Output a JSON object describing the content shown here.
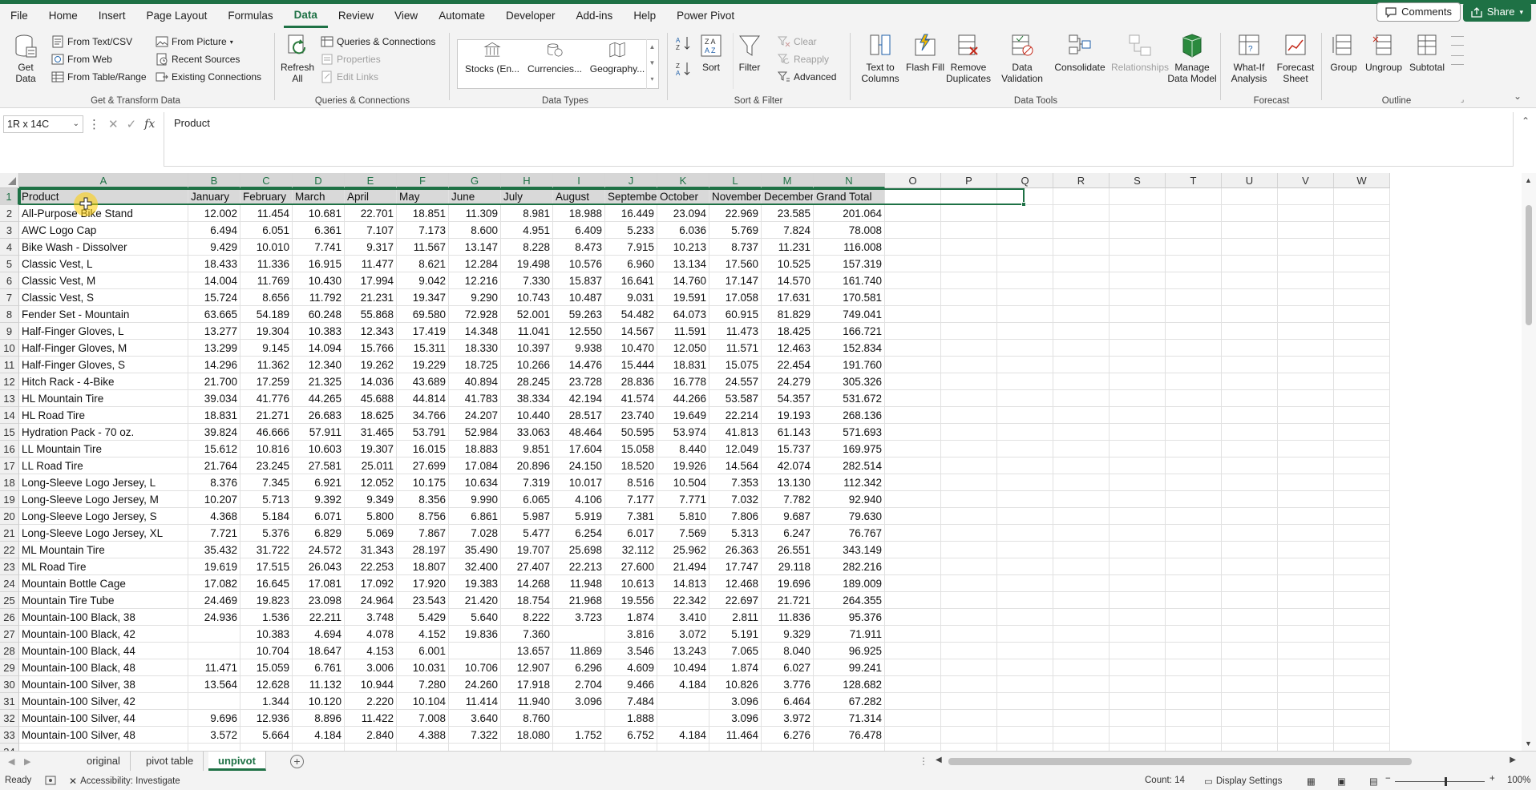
{
  "menu": {
    "items": [
      "File",
      "Home",
      "Insert",
      "Page Layout",
      "Formulas",
      "Data",
      "Review",
      "View",
      "Automate",
      "Developer",
      "Add-ins",
      "Help",
      "Power Pivot"
    ],
    "active": "Data",
    "comments_label": "Comments",
    "share_label": "Share"
  },
  "ribbon": {
    "get_data": {
      "get_data_label": "Get Data",
      "from_text_csv": "From Text/CSV",
      "from_web": "From Web",
      "from_table_range": "From Table/Range",
      "from_picture": "From Picture",
      "recent_sources": "Recent Sources",
      "existing_connections": "Existing Connections",
      "group_label": "Get & Transform Data"
    },
    "queries": {
      "refresh_all": "Refresh All",
      "queries_connections": "Queries & Connections",
      "properties": "Properties",
      "edit_links": "Edit Links",
      "group_label": "Queries & Connections"
    },
    "data_types": {
      "stocks": "Stocks (En...",
      "currencies": "Currencies...",
      "geography": "Geography...",
      "group_label": "Data Types"
    },
    "sort_filter": {
      "sort": "Sort",
      "filter": "Filter",
      "clear": "Clear",
      "reapply": "Reapply",
      "advanced": "Advanced",
      "group_label": "Sort & Filter"
    },
    "data_tools": {
      "text_to_columns": "Text to Columns",
      "flash_fill": "Flash Fill",
      "remove_duplicates": "Remove Duplicates",
      "data_validation": "Data Validation",
      "consolidate": "Consolidate",
      "relationships": "Relationships",
      "manage_data_model": "Manage Data Model",
      "group_label": "Data Tools"
    },
    "forecast": {
      "what_if": "What-If Analysis",
      "forecast_sheet": "Forecast Sheet",
      "group_label": "Forecast"
    },
    "outline": {
      "group": "Group",
      "ungroup": "Ungroup",
      "subtotal": "Subtotal",
      "group_label": "Outline"
    }
  },
  "formula_bar": {
    "name_box": "1R x 14C",
    "fx": "fx",
    "content": "Product"
  },
  "grid": {
    "columns": [
      "A",
      "B",
      "C",
      "D",
      "E",
      "F",
      "G",
      "H",
      "I",
      "J",
      "K",
      "L",
      "M",
      "N",
      "O",
      "P",
      "Q",
      "R",
      "S",
      "T",
      "U",
      "V",
      "W"
    ],
    "rows": [
      [
        "Product",
        "January",
        "February",
        "March",
        "April",
        "May",
        "June",
        "July",
        "August",
        "September",
        "October",
        "November",
        "December",
        "Grand Total"
      ],
      [
        "All-Purpose Bike Stand",
        "12.002",
        "11.454",
        "10.681",
        "22.701",
        "18.851",
        "11.309",
        "8.981",
        "18.988",
        "16.449",
        "23.094",
        "22.969",
        "23.585",
        "201.064"
      ],
      [
        "AWC Logo Cap",
        "6.494",
        "6.051",
        "6.361",
        "7.107",
        "7.173",
        "8.600",
        "4.951",
        "6.409",
        "5.233",
        "6.036",
        "5.769",
        "7.824",
        "78.008"
      ],
      [
        "Bike Wash - Dissolver",
        "9.429",
        "10.010",
        "7.741",
        "9.317",
        "11.567",
        "13.147",
        "8.228",
        "8.473",
        "7.915",
        "10.213",
        "8.737",
        "11.231",
        "116.008"
      ],
      [
        "Classic Vest, L",
        "18.433",
        "11.336",
        "16.915",
        "11.477",
        "8.621",
        "12.284",
        "19.498",
        "10.576",
        "6.960",
        "13.134",
        "17.560",
        "10.525",
        "157.319"
      ],
      [
        "Classic Vest, M",
        "14.004",
        "11.769",
        "10.430",
        "17.994",
        "9.042",
        "12.216",
        "7.330",
        "15.837",
        "16.641",
        "14.760",
        "17.147",
        "14.570",
        "161.740"
      ],
      [
        "Classic Vest, S",
        "15.724",
        "8.656",
        "11.792",
        "21.231",
        "19.347",
        "9.290",
        "10.743",
        "10.487",
        "9.031",
        "19.591",
        "17.058",
        "17.631",
        "170.581"
      ],
      [
        "Fender Set - Mountain",
        "63.665",
        "54.189",
        "60.248",
        "55.868",
        "69.580",
        "72.928",
        "52.001",
        "59.263",
        "54.482",
        "64.073",
        "60.915",
        "81.829",
        "749.041"
      ],
      [
        "Half-Finger Gloves, L",
        "13.277",
        "19.304",
        "10.383",
        "12.343",
        "17.419",
        "14.348",
        "11.041",
        "12.550",
        "14.567",
        "11.591",
        "11.473",
        "18.425",
        "166.721"
      ],
      [
        "Half-Finger Gloves, M",
        "13.299",
        "9.145",
        "14.094",
        "15.766",
        "15.311",
        "18.330",
        "10.397",
        "9.938",
        "10.470",
        "12.050",
        "11.571",
        "12.463",
        "152.834"
      ],
      [
        "Half-Finger Gloves, S",
        "14.296",
        "11.362",
        "12.340",
        "19.262",
        "19.229",
        "18.725",
        "10.266",
        "14.476",
        "15.444",
        "18.831",
        "15.075",
        "22.454",
        "191.760"
      ],
      [
        "Hitch Rack - 4-Bike",
        "21.700",
        "17.259",
        "21.325",
        "14.036",
        "43.689",
        "40.894",
        "28.245",
        "23.728",
        "28.836",
        "16.778",
        "24.557",
        "24.279",
        "305.326"
      ],
      [
        "HL Mountain Tire",
        "39.034",
        "41.776",
        "44.265",
        "45.688",
        "44.814",
        "41.783",
        "38.334",
        "42.194",
        "41.574",
        "44.266",
        "53.587",
        "54.357",
        "531.672"
      ],
      [
        "HL Road Tire",
        "18.831",
        "21.271",
        "26.683",
        "18.625",
        "34.766",
        "24.207",
        "10.440",
        "28.517",
        "23.740",
        "19.649",
        "22.214",
        "19.193",
        "268.136"
      ],
      [
        "Hydration Pack - 70 oz.",
        "39.824",
        "46.666",
        "57.911",
        "31.465",
        "53.791",
        "52.984",
        "33.063",
        "48.464",
        "50.595",
        "53.974",
        "41.813",
        "61.143",
        "571.693"
      ],
      [
        "LL Mountain Tire",
        "15.612",
        "10.816",
        "10.603",
        "19.307",
        "16.015",
        "18.883",
        "9.851",
        "17.604",
        "15.058",
        "8.440",
        "12.049",
        "15.737",
        "169.975"
      ],
      [
        "LL Road Tire",
        "21.764",
        "23.245",
        "27.581",
        "25.011",
        "27.699",
        "17.084",
        "20.896",
        "24.150",
        "18.520",
        "19.926",
        "14.564",
        "42.074",
        "282.514"
      ],
      [
        "Long-Sleeve Logo Jersey, L",
        "8.376",
        "7.345",
        "6.921",
        "12.052",
        "10.175",
        "10.634",
        "7.319",
        "10.017",
        "8.516",
        "10.504",
        "7.353",
        "13.130",
        "112.342"
      ],
      [
        "Long-Sleeve Logo Jersey, M",
        "10.207",
        "5.713",
        "9.392",
        "9.349",
        "8.356",
        "9.990",
        "6.065",
        "4.106",
        "7.177",
        "7.771",
        "7.032",
        "7.782",
        "92.940"
      ],
      [
        "Long-Sleeve Logo Jersey, S",
        "4.368",
        "5.184",
        "6.071",
        "5.800",
        "8.756",
        "6.861",
        "5.987",
        "5.919",
        "7.381",
        "5.810",
        "7.806",
        "9.687",
        "79.630"
      ],
      [
        "Long-Sleeve Logo Jersey, XL",
        "7.721",
        "5.376",
        "6.829",
        "5.069",
        "7.867",
        "7.028",
        "5.477",
        "6.254",
        "6.017",
        "7.569",
        "5.313",
        "6.247",
        "76.767"
      ],
      [
        "ML Mountain Tire",
        "35.432",
        "31.722",
        "24.572",
        "31.343",
        "28.197",
        "35.490",
        "19.707",
        "25.698",
        "32.112",
        "25.962",
        "26.363",
        "26.551",
        "343.149"
      ],
      [
        "ML Road Tire",
        "19.619",
        "17.515",
        "26.043",
        "22.253",
        "18.807",
        "32.400",
        "27.407",
        "22.213",
        "27.600",
        "21.494",
        "17.747",
        "29.118",
        "282.216"
      ],
      [
        "Mountain Bottle Cage",
        "17.082",
        "16.645",
        "17.081",
        "17.092",
        "17.920",
        "19.383",
        "14.268",
        "11.948",
        "10.613",
        "14.813",
        "12.468",
        "19.696",
        "189.009"
      ],
      [
        "Mountain Tire Tube",
        "24.469",
        "19.823",
        "23.098",
        "24.964",
        "23.543",
        "21.420",
        "18.754",
        "21.968",
        "19.556",
        "22.342",
        "22.697",
        "21.721",
        "264.355"
      ],
      [
        "Mountain-100 Black, 38",
        "24.936",
        "1.536",
        "22.211",
        "3.748",
        "5.429",
        "5.640",
        "8.222",
        "3.723",
        "1.874",
        "3.410",
        "2.811",
        "11.836",
        "95.376"
      ],
      [
        "Mountain-100 Black, 42",
        "",
        "10.383",
        "4.694",
        "4.078",
        "4.152",
        "19.836",
        "7.360",
        "",
        "3.816",
        "3.072",
        "5.191",
        "9.329",
        "71.911"
      ],
      [
        "Mountain-100 Black, 44",
        "",
        "10.704",
        "18.647",
        "4.153",
        "6.001",
        "",
        "13.657",
        "11.869",
        "3.546",
        "13.243",
        "7.065",
        "8.040",
        "96.925"
      ],
      [
        "Mountain-100 Black, 48",
        "11.471",
        "15.059",
        "6.761",
        "3.006",
        "10.031",
        "10.706",
        "12.907",
        "6.296",
        "4.609",
        "10.494",
        "1.874",
        "6.027",
        "99.241"
      ],
      [
        "Mountain-100 Silver, 38",
        "13.564",
        "12.628",
        "11.132",
        "10.944",
        "7.280",
        "24.260",
        "17.918",
        "2.704",
        "9.466",
        "4.184",
        "10.826",
        "3.776",
        "128.682"
      ],
      [
        "Mountain-100 Silver, 42",
        "",
        "1.344",
        "10.120",
        "2.220",
        "10.104",
        "11.414",
        "11.940",
        "3.096",
        "7.484",
        "",
        "3.096",
        "6.464",
        "67.282"
      ],
      [
        "Mountain-100 Silver, 44",
        "9.696",
        "12.936",
        "8.896",
        "11.422",
        "7.008",
        "3.640",
        "8.760",
        "",
        "1.888",
        "",
        "3.096",
        "3.972",
        "71.314"
      ],
      [
        "Mountain-100 Silver, 48",
        "3.572",
        "5.664",
        "4.184",
        "2.840",
        "4.388",
        "7.322",
        "18.080",
        "1.752",
        "6.752",
        "4.184",
        "11.464",
        "6.276",
        "76.478"
      ]
    ]
  },
  "sheets": {
    "tabs": [
      "original",
      "pivot table",
      "unpivot"
    ],
    "active": "unpivot"
  },
  "status": {
    "ready": "Ready",
    "accessibility": "Accessibility: Investigate",
    "count": "Count: 14",
    "display_settings": "Display Settings",
    "zoom": "100%"
  },
  "colors": {
    "accent": "#1e7145",
    "header_fill": "#d9d9d9"
  }
}
